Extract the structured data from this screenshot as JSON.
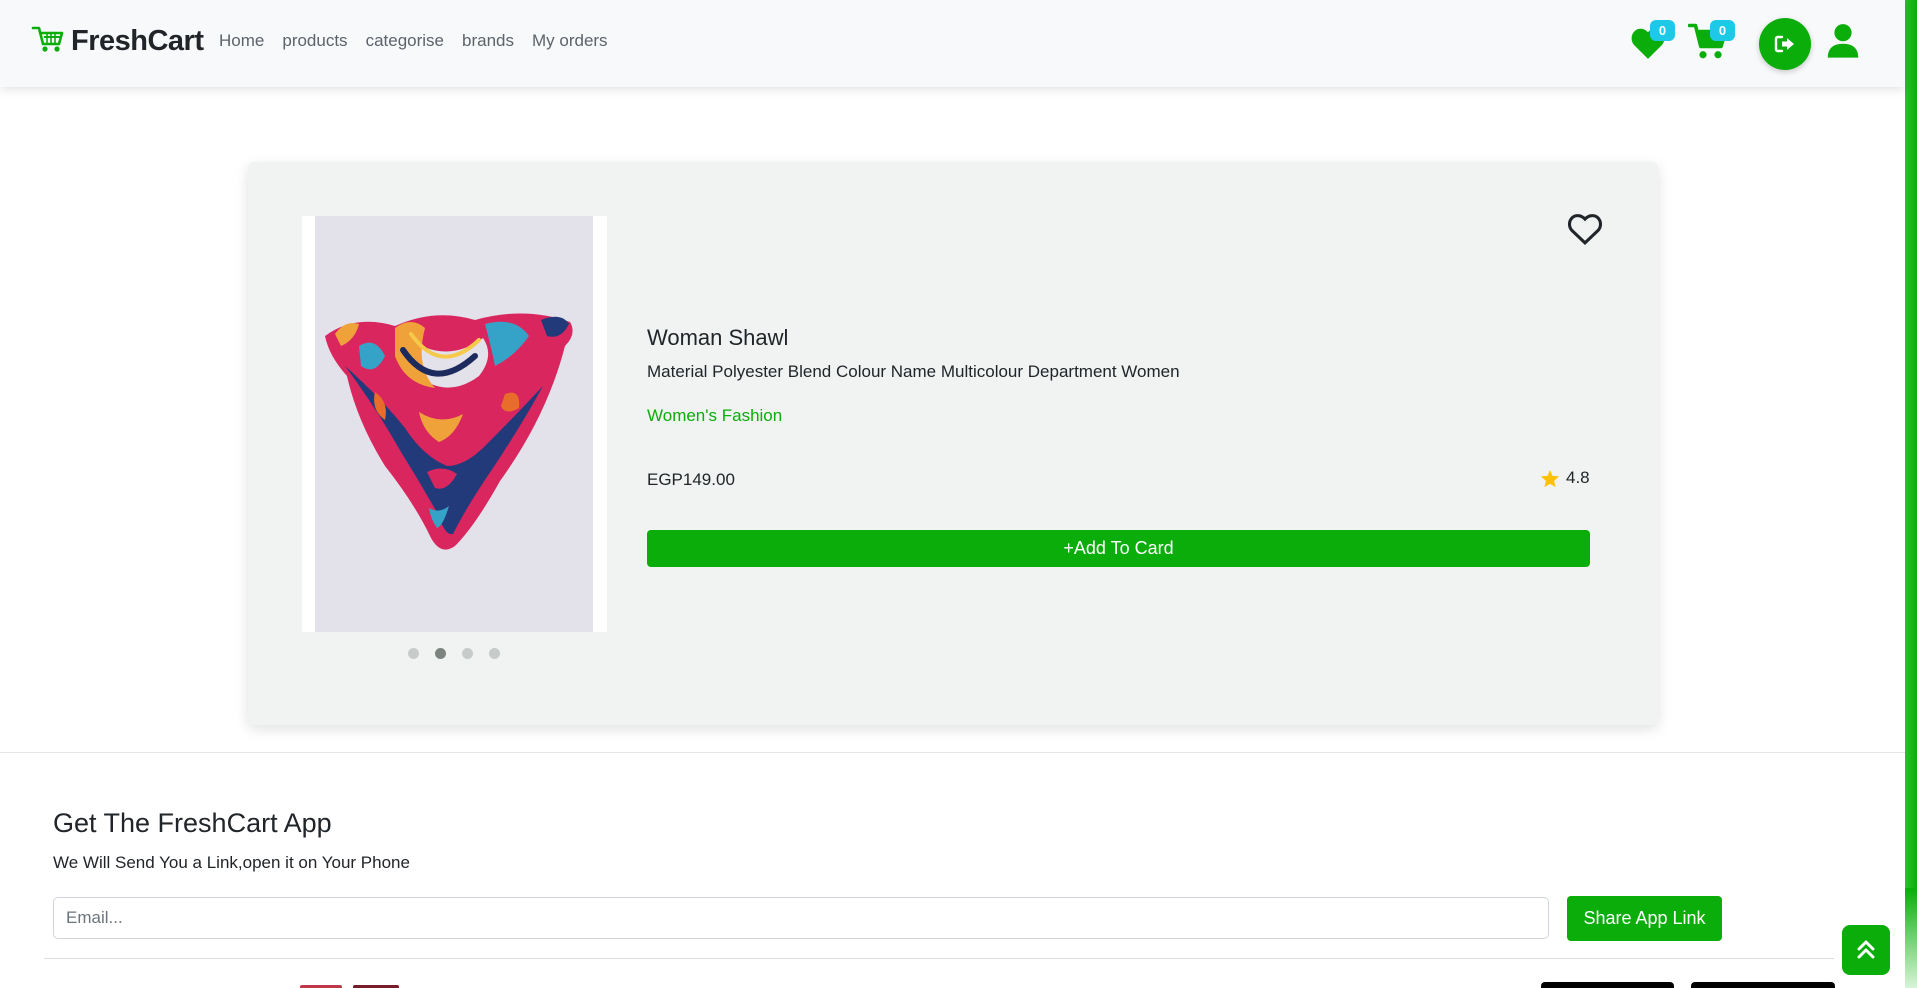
{
  "brand": {
    "name": "FreshCart",
    "icon": "cart-icon"
  },
  "nav": {
    "links": [
      "Home",
      "products",
      "categorise",
      "brands",
      "My orders"
    ]
  },
  "header_actions": {
    "wishlist_count": "0",
    "cart_count": "0",
    "logout_icon": "logout-icon",
    "profile_icon": "user-icon"
  },
  "product": {
    "title": "Woman Shawl",
    "description": "Material Polyester Blend Colour Name Multicolour Department Women",
    "category": "Women's Fashion",
    "price": "EGP149.00",
    "rating": "4.8",
    "add_button": "+Add To Card",
    "image_slides": 4,
    "active_slide": 2
  },
  "footer": {
    "title": "Get The FreshCart App",
    "subtitle": "We Will Send You a Link,open it on Your Phone",
    "email_placeholder": "Email...",
    "share_button": "Share App Link"
  },
  "colors": {
    "accent": "#0aad0a",
    "badge": "#1ec8e7",
    "star": "#ffc107"
  }
}
